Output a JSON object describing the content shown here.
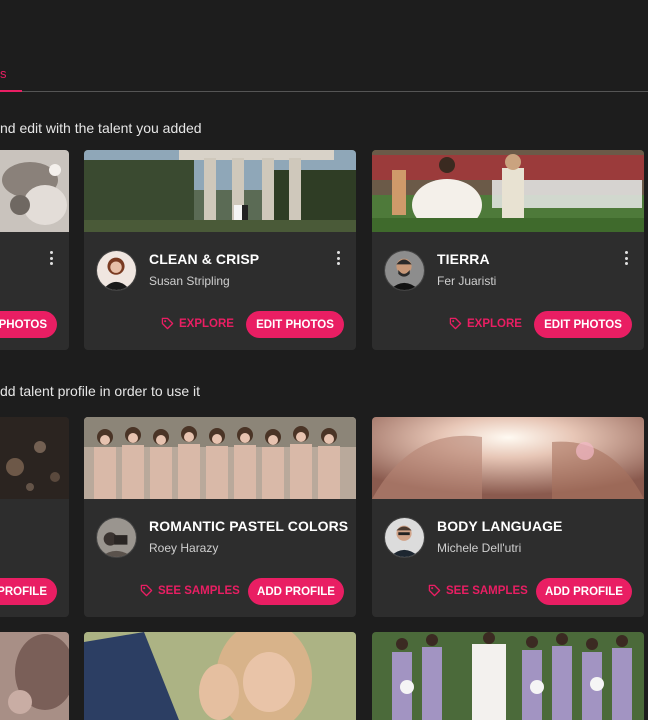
{
  "tabs": {
    "active_fragment": "s"
  },
  "sections": {
    "added_heading": "nd edit with the talent you added",
    "add_heading": "dd talent profile in order to use it"
  },
  "added_cards": [
    {
      "title": "CLEAN & CRISP",
      "author": "Susan Stripling",
      "link_label": "EXPLORE",
      "button_label": "EDIT PHOTOS"
    },
    {
      "title": "TIERRA",
      "author": "Fer Juaristi",
      "link_label": "EXPLORE",
      "button_label": "EDIT PHOTOS"
    }
  ],
  "add_cards": [
    {
      "title": "ROMANTIC PASTEL COLORS",
      "author": "Roey Harazy",
      "link_label": "SEE SAMPLES",
      "button_label": "ADD PROFILE"
    },
    {
      "title": "BODY LANGUAGE",
      "author": "Michele Dell'utri",
      "link_label": "SEE SAMPLES",
      "button_label": "ADD PROFILE"
    }
  ],
  "partial_buttons": {
    "row1": "PHOTOS",
    "row2": "PROFILE"
  },
  "colors": {
    "accent": "#e91e63",
    "background": "#1d1d1d",
    "card": "#2d2d2d"
  }
}
